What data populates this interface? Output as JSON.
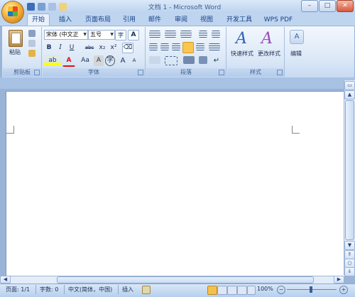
{
  "window": {
    "title": "文档 1 - Microsoft Word",
    "controls": {
      "minimize": "–",
      "maximize": "□",
      "close": "✕"
    }
  },
  "tabs": [
    {
      "label": "开始",
      "active": true
    },
    {
      "label": "插入"
    },
    {
      "label": "页面布局"
    },
    {
      "label": "引用"
    },
    {
      "label": "邮件"
    },
    {
      "label": "审阅"
    },
    {
      "label": "视图"
    },
    {
      "label": "开发工具"
    },
    {
      "label": "WPS PDF"
    }
  ],
  "ribbon": {
    "clipboard": {
      "label": "剪贴板",
      "paste": "粘贴"
    },
    "font": {
      "label": "字体",
      "font_name": "宋体 (中文正",
      "font_size": "五号",
      "bold": "B",
      "italic": "I",
      "underline": "U",
      "strike": "abc",
      "subscript": "x₂",
      "superscript": "x²",
      "grow": "A",
      "shrink": "A",
      "case": "Aa",
      "char_border": "A",
      "highlight": "ab",
      "font_color": "A",
      "char_shade": "A",
      "enclose": "字",
      "phonetic": "wén",
      "clear": "A"
    },
    "paragraph": {
      "label": "段落"
    },
    "styles": {
      "label": "样式",
      "quick_styles": "快速样式",
      "change_styles": "更改样式"
    },
    "editing": {
      "label": "编辑"
    }
  },
  "statusbar": {
    "page": "页面: 1/1",
    "words": "字数: 0",
    "language": "中文(简体，中国)",
    "mode": "插入",
    "zoom": "100%"
  },
  "colors": {
    "accent": "#15428b",
    "ribbon_bg": "#dde9f7",
    "workspace": "#9ab4d8",
    "highlight_yellow": "#ffff00",
    "font_red": "#e01010"
  }
}
